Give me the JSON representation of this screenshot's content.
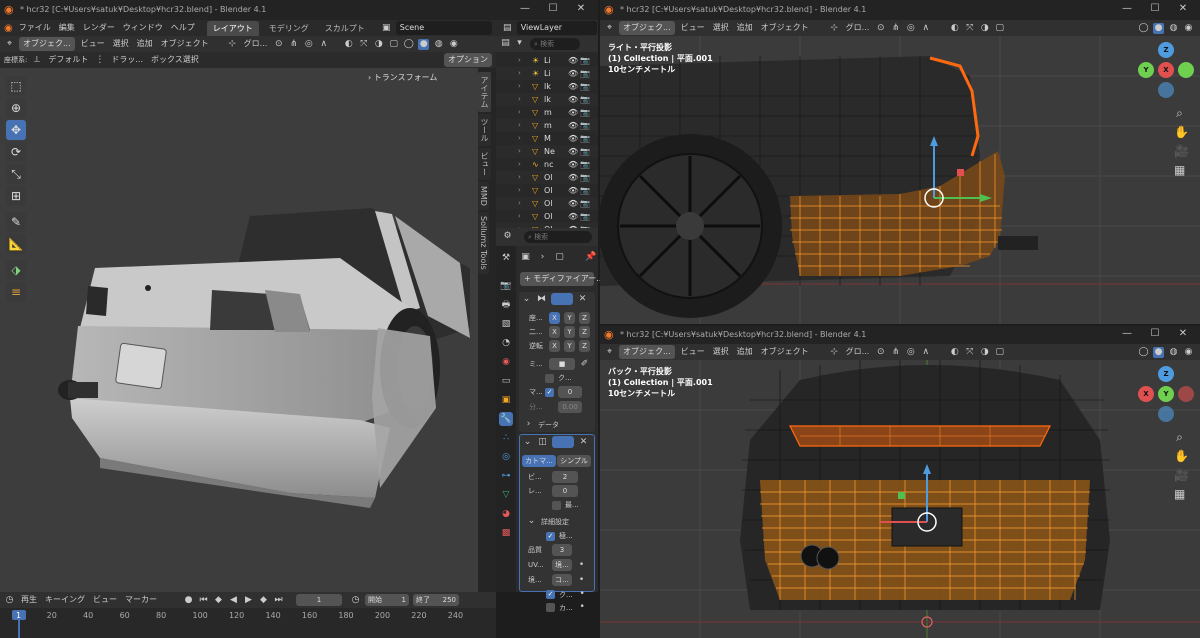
{
  "main_window": {
    "title": "* hcr32 [C:¥Users¥satuk¥Desktop¥hcr32.blend] - Blender 4.1",
    "menu": [
      "ファイル",
      "編集",
      "レンダー",
      "ウィンドウ",
      "ヘルプ"
    ],
    "workspace_tabs": [
      "レイアウト",
      "モデリング",
      "スカルプト"
    ],
    "scene": "Scene",
    "view_layer": "ViewLayer"
  },
  "viewport_left": {
    "mode": "オブジェク...",
    "menus": [
      "ビュー",
      "選択",
      "追加",
      "オブジェクト"
    ],
    "orientation": "グロ...",
    "coord_label": "座標系:",
    "coord_value": "デフォルト",
    "drag_label": "ドラッ...",
    "select_mode": "ボックス選択",
    "options": "オプション",
    "transform_panel": "トランスフォーム",
    "side_tabs": [
      "アイテム",
      "ツール",
      "ビュー",
      "MMD",
      "Sollumz Tools"
    ]
  },
  "outliner": {
    "search_placeholder": "検索",
    "items": [
      {
        "name": "Li",
        "type": "light"
      },
      {
        "name": "Li",
        "type": "light"
      },
      {
        "name": "lk",
        "type": "mesh"
      },
      {
        "name": "lk",
        "type": "mesh"
      },
      {
        "name": "m",
        "type": "mesh"
      },
      {
        "name": "m",
        "type": "mesh"
      },
      {
        "name": "M",
        "type": "mesh"
      },
      {
        "name": "Ne",
        "type": "mesh"
      },
      {
        "name": "nc",
        "type": "curve"
      },
      {
        "name": "Ol",
        "type": "mesh"
      },
      {
        "name": "Ol",
        "type": "mesh"
      },
      {
        "name": "Ol",
        "type": "mesh"
      },
      {
        "name": "Ol",
        "type": "mesh"
      },
      {
        "name": "Ol",
        "type": "mesh"
      }
    ]
  },
  "properties": {
    "search_placeholder": "検索",
    "add_modifier": "モディファイアー...",
    "mirror": {
      "axis_label": "座...",
      "bisect_label": "二...",
      "flip_label": "逆転",
      "x": "X",
      "y": "Y",
      "z": "Z",
      "mirror_obj_label": "ミ...",
      "clip_label": "ク...",
      "merge_label": "マ...",
      "merge_value": "0",
      "dist_label": "分...",
      "dist_value": "0.00",
      "data_label": "データ"
    },
    "subsurf": {
      "catmull": "カトマ...",
      "simple": "シンプル",
      "viewport_label": "ビ...",
      "viewport_value": "2",
      "render_label": "レ...",
      "render_value": "0",
      "optimal_label": "最...",
      "advanced_label": "詳細設定",
      "limit_label": "極...",
      "quality_label": "品質",
      "quality_value": "3",
      "uv_label": "UV...",
      "uv_value": "境...",
      "boundary_label": "境...",
      "boundary_value": "コ...",
      "use_crease_label": "ク...",
      "custom_normals_label": "カ..."
    }
  },
  "timeline": {
    "playback": "再生",
    "keying": "キーイング",
    "view": "ビュー",
    "marker": "マーカー",
    "current_frame": "1",
    "start_label": "開始",
    "start_value": "1",
    "end_label": "終了",
    "end_value": "250",
    "ticks": [
      "1",
      "20",
      "40",
      "60",
      "80",
      "100",
      "120",
      "140",
      "160",
      "180",
      "200",
      "220",
      "240"
    ]
  },
  "right_top_window": {
    "title": "* hcr32 [C:¥Users¥satuk¥Desktop¥hcr32.blend] - Blender 4.1",
    "mode": "オブジェク...",
    "menus": [
      "ビュー",
      "選択",
      "追加",
      "オブジェクト"
    ],
    "orientation": "グロ...",
    "overlay_view": "ライト・平行投影",
    "overlay_collection": "(1) Collection | 平面.001",
    "overlay_scale": "10センチメートル"
  },
  "right_bottom_window": {
    "title": "* hcr32 [C:¥Users¥satuk¥Desktop¥hcr32.blend] - Blender 4.1",
    "mode": "オブジェク...",
    "menus": [
      "ビュー",
      "選択",
      "追加",
      "オブジェクト"
    ],
    "orientation": "グロ...",
    "overlay_view": "バック・平行投影",
    "overlay_collection": "(1) Collection | 平面.001",
    "overlay_scale": "10センチメートル"
  },
  "gizmo": {
    "x": "X",
    "y": "Y",
    "z": "Z"
  },
  "colors": {
    "accent": "#4772b3",
    "selection": "#ff8c1a",
    "active_edge": "#e06020"
  }
}
